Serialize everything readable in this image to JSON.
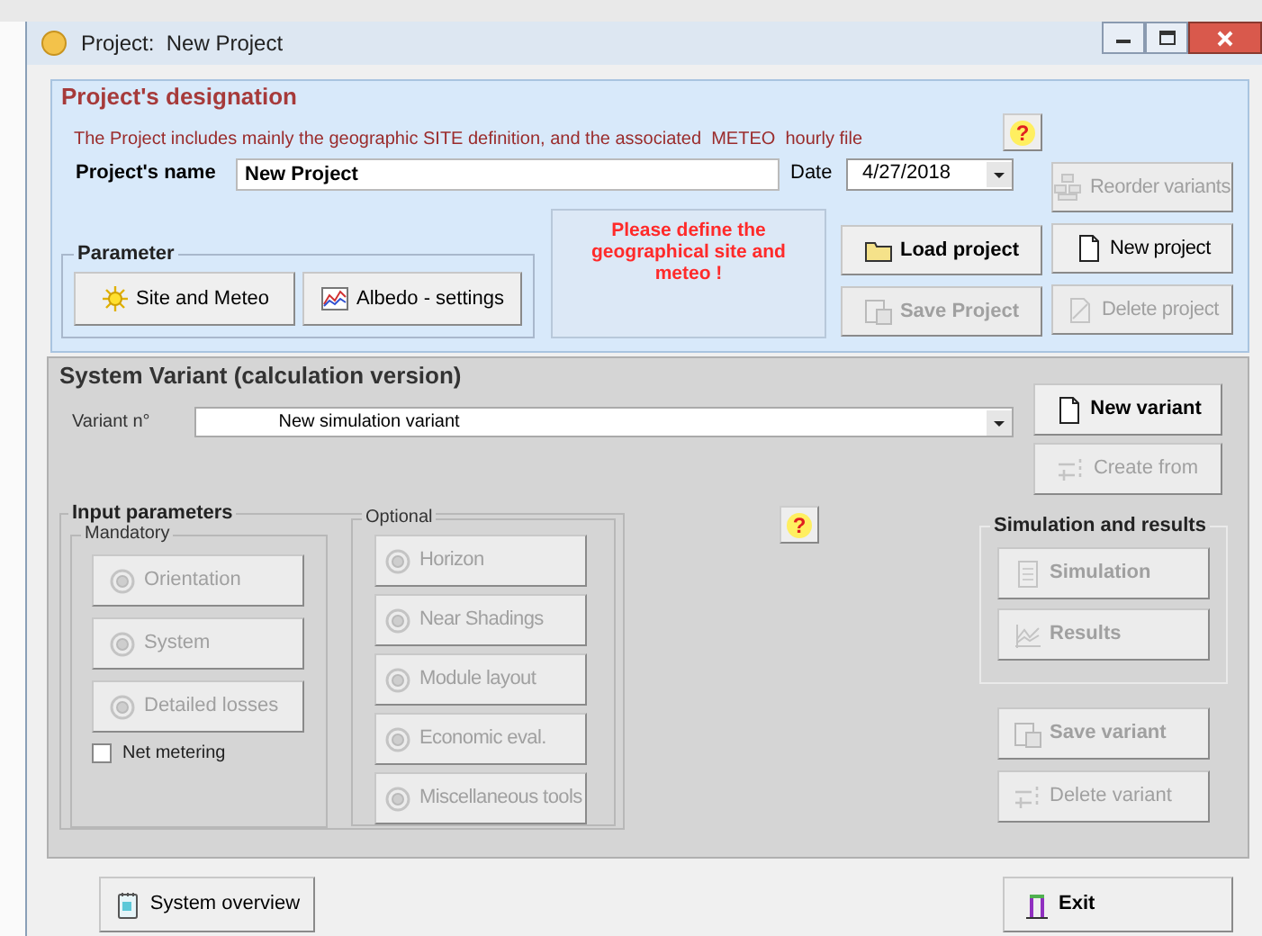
{
  "window": {
    "title": "Project:  New Project"
  },
  "designation": {
    "title": "Project's designation",
    "description": "The Project includes mainly the geographic SITE definition, and the associated  METEO  hourly file",
    "help": "?",
    "name_label": "Project's name",
    "name_value": "New Project",
    "date_label": "Date",
    "date_value": "4/27/2018",
    "warning": "Please define the geographical site and meteo !",
    "parameter": {
      "title": "Parameter",
      "buttons": [
        {
          "label": "Site and Meteo",
          "disabled": false,
          "bold": false
        },
        {
          "label": "Albedo - settings",
          "disabled": false,
          "bold": false
        }
      ]
    },
    "actions_left": [
      {
        "label": "Load project",
        "disabled": false,
        "bold": true
      },
      {
        "label": "Save Project",
        "disabled": true,
        "bold": true
      }
    ],
    "actions_right": [
      {
        "label": "Reorder variants",
        "disabled": true,
        "bold": false
      },
      {
        "label": "New project",
        "disabled": false,
        "bold": false
      },
      {
        "label": "Delete project",
        "disabled": true,
        "bold": false
      }
    ]
  },
  "variant": {
    "title": "System Variant (calculation version)",
    "variant_label": "Variant n°",
    "variant_value": "New simulation variant",
    "variant_buttons": [
      {
        "label": "New variant",
        "disabled": false,
        "bold": true
      },
      {
        "label": "Create from",
        "disabled": true,
        "bold": false
      }
    ],
    "input": {
      "title": "Input parameters",
      "mandatory": {
        "title": "Mandatory",
        "buttons": [
          {
            "label": "Orientation",
            "disabled": true,
            "bold": false
          },
          {
            "label": "System",
            "disabled": true,
            "bold": false
          },
          {
            "label": "Detailed losses",
            "disabled": true,
            "bold": false
          }
        ],
        "net_metering": {
          "label": "Net metering",
          "checked": false
        }
      },
      "optional": {
        "title": "Optional",
        "buttons": [
          {
            "label": "Horizon",
            "disabled": true,
            "bold": false
          },
          {
            "label": "Near Shadings",
            "disabled": true,
            "bold": false
          },
          {
            "label": "Module layout",
            "disabled": true,
            "bold": false
          },
          {
            "label": "Economic eval.",
            "disabled": true,
            "bold": false
          },
          {
            "label": "Miscellaneous tools",
            "disabled": true,
            "bold": false
          }
        ]
      }
    },
    "help": "?",
    "results": {
      "title": "Simulation and results",
      "buttons": [
        {
          "label": "Simulation",
          "disabled": true,
          "bold": true
        },
        {
          "label": "Results",
          "disabled": true,
          "bold": true
        }
      ]
    },
    "save_buttons": [
      {
        "label": "Save variant",
        "disabled": true,
        "bold": true
      },
      {
        "label": "Delete variant",
        "disabled": true,
        "bold": false
      }
    ]
  },
  "footer": {
    "buttons": [
      {
        "label": "System overview",
        "disabled": false,
        "bold": false
      },
      {
        "label": "Exit",
        "disabled": false,
        "bold": true
      }
    ]
  }
}
